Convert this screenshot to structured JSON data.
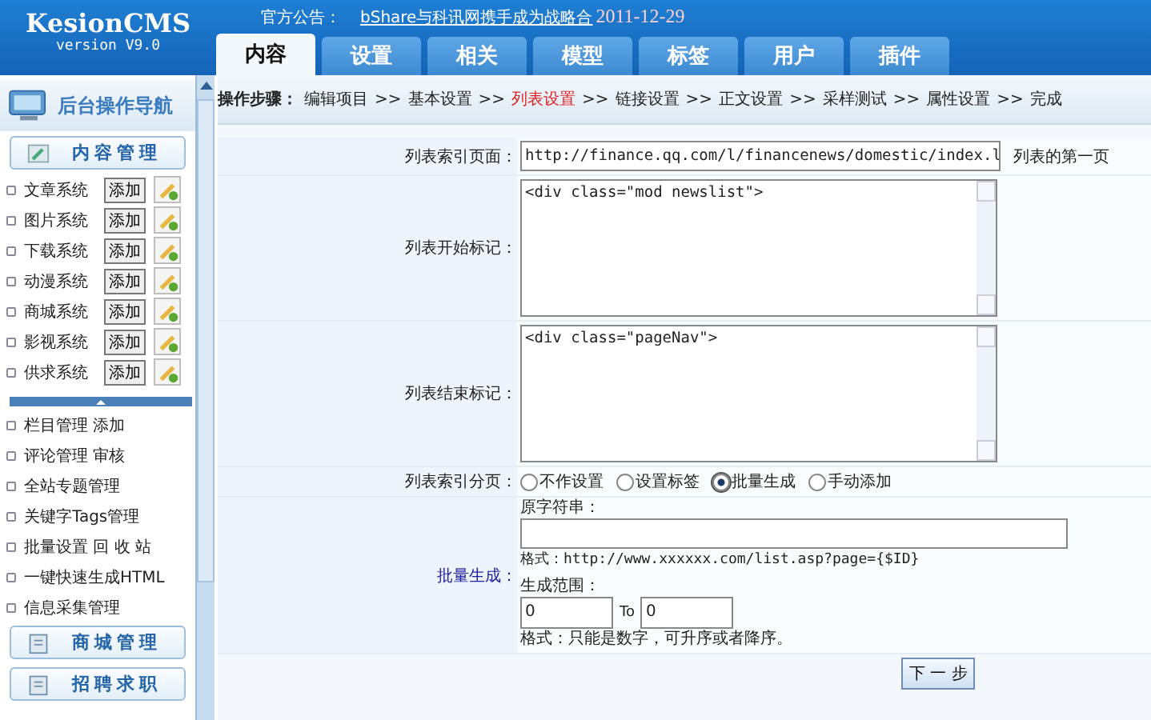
{
  "logo": {
    "name": "KesionCMS",
    "version": "version V9.0"
  },
  "announcement": {
    "label": "官方公告：",
    "link": "bShare与科讯网携手成为战略合",
    "date": "2011-12-29"
  },
  "tabs": [
    {
      "label": "内容",
      "selected": true
    },
    {
      "label": "设置",
      "selected": false
    },
    {
      "label": "相关",
      "selected": false
    },
    {
      "label": "模型",
      "selected": false
    },
    {
      "label": "标签",
      "selected": false
    },
    {
      "label": "用户",
      "selected": false
    },
    {
      "label": "插件",
      "selected": false
    }
  ],
  "sidebar": {
    "title": "后台操作导航",
    "section": "内容管理",
    "systems": [
      {
        "name": "文章系统",
        "add": "添加"
      },
      {
        "name": "图片系统",
        "add": "添加"
      },
      {
        "name": "下载系统",
        "add": "添加"
      },
      {
        "name": "动漫系统",
        "add": "添加"
      },
      {
        "name": "商城系统",
        "add": "添加"
      },
      {
        "name": "影视系统",
        "add": "添加"
      },
      {
        "name": "供求系统",
        "add": "添加"
      }
    ],
    "links": [
      "栏目管理 添加",
      "评论管理 审核",
      "全站专题管理",
      "关键字Tags管理",
      "批量设置 回 收 站",
      "一键快速生成HTML",
      "信息采集管理"
    ],
    "panels": [
      "商城管理",
      "招聘求职"
    ]
  },
  "steps": {
    "label": "操作步骤：",
    "separator": ">>",
    "items": [
      {
        "text": "编辑项目",
        "selected": false
      },
      {
        "text": "基本设置",
        "selected": false
      },
      {
        "text": "列表设置",
        "selected": true
      },
      {
        "text": "链接设置",
        "selected": false
      },
      {
        "text": "正文设置",
        "selected": false
      },
      {
        "text": "采样测试",
        "selected": false
      },
      {
        "text": "属性设置",
        "selected": false
      },
      {
        "text": "完成",
        "selected": false
      }
    ]
  },
  "form": [
    {
      "kind": "text",
      "label": "列表索引页面：",
      "value": "http://finance.qq.com/l/financenews/domestic/index.l",
      "note": "列表的第一页"
    },
    {
      "kind": "textarea",
      "label": "列表开始标记：",
      "value": "<div class=\"mod newslist\">"
    },
    {
      "kind": "textarea",
      "label": "列表结束标记：",
      "value": "<div class=\"pageNav\">"
    },
    {
      "kind": "radio",
      "label": "列表索引分页：",
      "options": [
        {
          "label": "不作设置",
          "selected": false
        },
        {
          "label": "设置标签",
          "selected": false
        },
        {
          "label": "批量生成",
          "selected": true
        },
        {
          "label": "手动添加",
          "selected": false
        }
      ]
    },
    {
      "kind": "batch",
      "label": "批量生成：",
      "source_label": "原字符串：",
      "format": "格式：http://www.xxxxxx.com/list.asp?page={$ID}",
      "range_label": "生成范围：",
      "from": "0",
      "to_label": "To",
      "to": "0",
      "range_note": "格式：只能是数字，可升序或者降序。"
    }
  ],
  "next_button": "下 一 步"
}
